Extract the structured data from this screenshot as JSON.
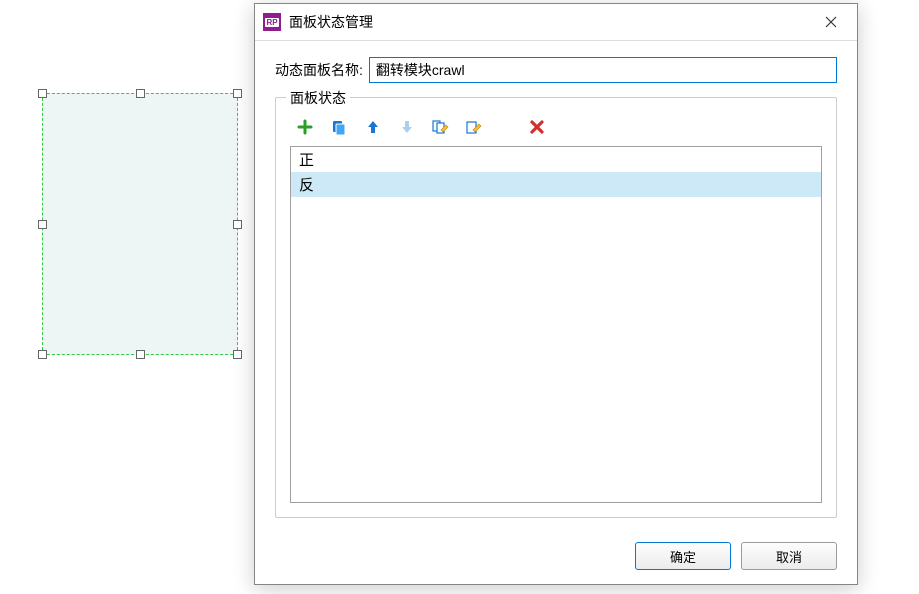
{
  "dialog": {
    "title": "面板状态管理",
    "name_label": "动态面板名称:",
    "name_value": "翻转模块crawl",
    "group_label": "面板状态",
    "toolbar": {
      "add": "add-icon",
      "duplicate": "duplicate-icon",
      "move_up": "arrow-up-icon",
      "move_down": "arrow-down-icon",
      "edit_all": "edit-all-icon",
      "edit_state": "edit-state-icon",
      "delete": "delete-icon"
    },
    "states": [
      {
        "label": "正",
        "selected": false
      },
      {
        "label": "反",
        "selected": true
      }
    ],
    "ok_label": "确定",
    "cancel_label": "取消"
  }
}
